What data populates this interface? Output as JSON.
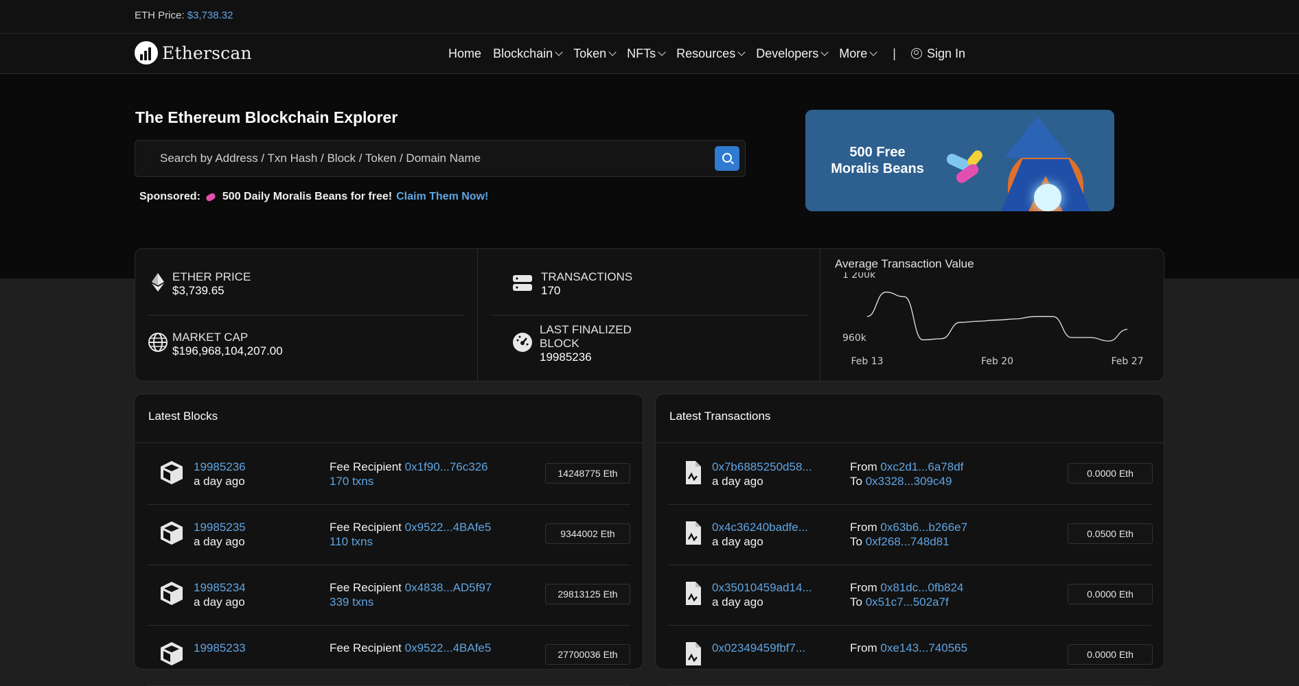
{
  "price_bar": {
    "label": "ETH Price:",
    "value": "$3,738.32"
  },
  "nav": {
    "logo_text": "Etherscan",
    "items": [
      "Home",
      "Blockchain",
      "Token",
      "NFTs",
      "Resources",
      "Developers",
      "More"
    ],
    "separator": "|",
    "sign_in": "Sign In"
  },
  "hero": {
    "title": "The Ethereum Blockchain Explorer",
    "search_placeholder": "Search by Address / Txn Hash / Block / Token / Domain Name",
    "sponsored_label": "Sponsored:",
    "sponsored_text": "500 Daily Moralis Beans for free!",
    "sponsored_link": "Claim Them Now!",
    "ad_text_line1": "500 Free",
    "ad_text_line2": "Moralis Beans"
  },
  "stats": {
    "ether_price_label": "ETHER PRICE",
    "ether_price_value": "$3,739.65",
    "market_cap_label": "MARKET CAP",
    "market_cap_value": "$196,968,104,207.00",
    "transactions_label": "TRANSACTIONS",
    "transactions_value": "170",
    "last_block_label_1": "LAST FINALIZED",
    "last_block_label_2": "BLOCK",
    "last_block_value": "19985236"
  },
  "chart_data": {
    "type": "line",
    "title": "Average Transaction Value",
    "ytick_labels": [
      "1 200k",
      "960k"
    ],
    "xtick_labels": [
      "Feb 13",
      "Feb 20",
      "Feb 27"
    ],
    "x": [
      "Feb 13",
      "Feb 14",
      "Feb 15",
      "Feb 16",
      "Feb 17",
      "Feb 18",
      "Feb 19",
      "Feb 20",
      "Feb 21",
      "Feb 22",
      "Feb 23",
      "Feb 24",
      "Feb 25",
      "Feb 26",
      "Feb 27"
    ],
    "values": [
      1090000,
      1195000,
      1175000,
      990000,
      995000,
      1065000,
      1070000,
      1075000,
      1080000,
      1090000,
      1090000,
      1000000,
      1000000,
      985000,
      1035000
    ],
    "ylim": [
      950000,
      1215000
    ],
    "grid": false,
    "color": "#e6e6e6"
  },
  "latest_blocks": {
    "title": "Latest Blocks",
    "fee_label": "Fee Recipient",
    "rows": [
      {
        "block": "19985236",
        "age": "a day ago",
        "recipient": "0x1f90...76c326",
        "txns": "170 txns",
        "reward": "14248775 Eth"
      },
      {
        "block": "19985235",
        "age": "a day ago",
        "recipient": "0x9522...4BAfe5",
        "txns": "110 txns",
        "reward": "9344002 Eth"
      },
      {
        "block": "19985234",
        "age": "a day ago",
        "recipient": "0x4838...AD5f97",
        "txns": "339 txns",
        "reward": "29813125 Eth"
      },
      {
        "block": "19985233",
        "age": "",
        "recipient": "0x9522...4BAfe5",
        "txns": "",
        "reward": "27700036 Eth"
      }
    ]
  },
  "latest_transactions": {
    "title": "Latest Transactions",
    "from_label": "From",
    "to_label": "To",
    "rows": [
      {
        "hash": "0x7b6885250d58...",
        "age": "a day ago",
        "from": "0xc2d1...6a78df",
        "to": "0x3328...309c49",
        "value": "0.0000 Eth"
      },
      {
        "hash": "0x4c36240badfe...",
        "age": "a day ago",
        "from": "0x63b6...b266e7",
        "to": "0xf268...748d81",
        "value": "0.0500 Eth"
      },
      {
        "hash": "0x35010459ad14...",
        "age": "a day ago",
        "from": "0x81dc...0fb824",
        "to": "0x51c7...502a7f",
        "value": "0.0000 Eth"
      },
      {
        "hash": "0x02349459fbf7...",
        "age": "",
        "from": "0xe143...740565",
        "to": "",
        "value": "0.0000 Eth"
      }
    ]
  }
}
